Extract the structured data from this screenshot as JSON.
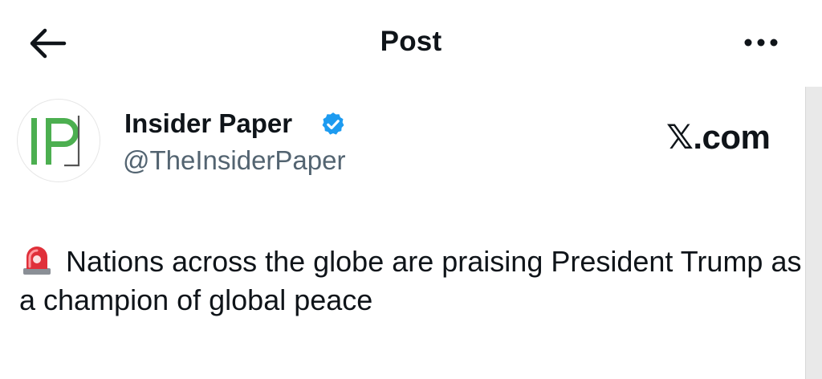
{
  "header": {
    "title": "Post"
  },
  "author": {
    "avatar_text": "IP",
    "name": "Insider Paper",
    "handle": "@TheInsiderPaper",
    "verified": true
  },
  "source_label": "𝕏.com",
  "post": {
    "icon": "rotating-light-siren-icon",
    "text": "Nations across the globe are praising President Trump as a champion of global peace"
  },
  "colors": {
    "verified_blue": "#1d9bf0",
    "avatar_green": "#4caf50",
    "handle_gray": "#536471",
    "siren_red": "#e0303a"
  }
}
